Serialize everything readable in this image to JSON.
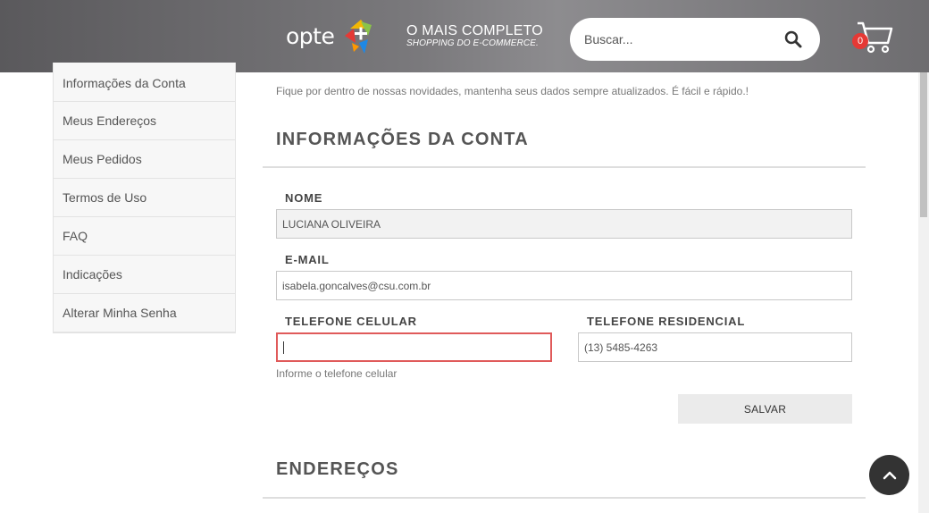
{
  "header": {
    "logo_text": "opte",
    "tagline_main": "O MAIS COMPLETO",
    "tagline_sub": "SHOPPING DO E-COMMERCE.",
    "search_placeholder": "Buscar...",
    "cart_count": "0",
    "search_icon": "search-icon",
    "cart_icon": "cart-icon"
  },
  "sidebar": {
    "items": [
      {
        "label": "Informações da Conta"
      },
      {
        "label": "Meus Endereços"
      },
      {
        "label": "Meus Pedidos"
      },
      {
        "label": "Termos de Uso"
      },
      {
        "label": "FAQ"
      },
      {
        "label": "Indicações"
      },
      {
        "label": "Alterar Minha Senha"
      }
    ]
  },
  "main": {
    "intro": "Fique por dentro de nossas novidades, mantenha seus dados sempre atualizados. É fácil e rápido.!",
    "account_title": "INFORMAÇÕES DA CONTA",
    "form": {
      "name_label": "NOME",
      "name_value": "LUCIANA OLIVEIRA",
      "email_label": "E-MAIL",
      "email_value": "isabela.goncalves@csu.com.br",
      "mobile_label": "TELEFONE CELULAR",
      "mobile_value": "",
      "mobile_help": "Informe o telefone celular",
      "home_label": "TELEFONE RESIDENCIAL",
      "home_value": "(13) 5485-4263",
      "save_label": "SALVAR"
    },
    "addresses_title": "ENDEREÇOS"
  },
  "colors": {
    "header_gradient_start": "#5a595c",
    "header_gradient_mid": "#8d8c8f",
    "error_border": "#e05a5a",
    "cart_badge": "#e53935",
    "back_to_top": "#333333"
  },
  "icons": {
    "back_to_top": "chevron-up-icon"
  }
}
